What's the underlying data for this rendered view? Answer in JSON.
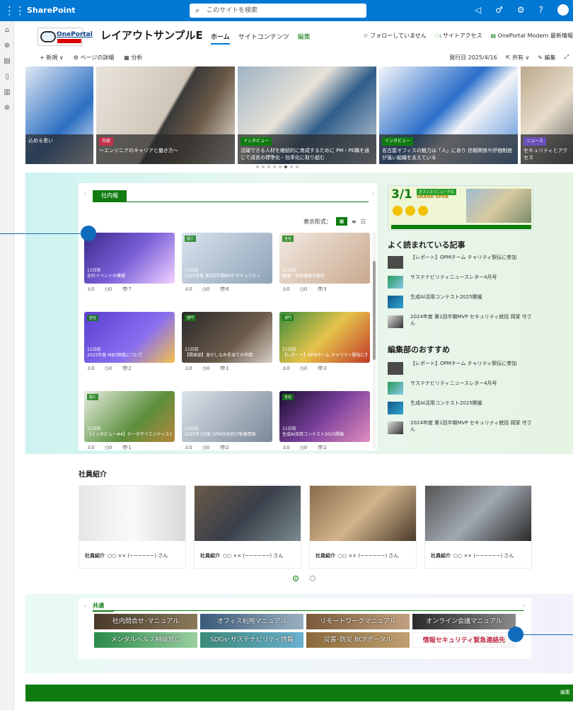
{
  "suitebar": {
    "app_name": "SharePoint",
    "search_placeholder": "このサイトを検索"
  },
  "header": {
    "logo_text": "OnePortal",
    "site_title": "レイアウトサンプルE",
    "nav": [
      "ホーム",
      "サイトコンテンツ",
      "編集"
    ],
    "follow": "☆ フォローしていません",
    "site_access": "サイトアクセス",
    "latest_info": "OnePortal Modern 最新情報"
  },
  "commandbar": {
    "new": "+ 新規 ∨",
    "page_details": "ページの詳細",
    "analytics": "分析",
    "published": "発行日 2025/4/16",
    "share": "共有 ∨",
    "edit": "編集"
  },
  "hero": [
    {
      "tag": "",
      "caption": "込める思い"
    },
    {
      "tag": "対談",
      "caption": "～エンジニアのキャリアと働き方～"
    },
    {
      "tag": "インタビュー",
      "caption": "活躍できる人材を継続的に育成するために PM・PE職を通じて成長の標準化・効率化に取り組む"
    },
    {
      "tag": "インタビュー",
      "caption": "名古屋オフィスの魅力は「人」にあり 信頼関係や評価制度が強い組織を支えている"
    },
    {
      "tag": "ニュース",
      "caption": "セキュリティとアクセス"
    }
  ],
  "news": {
    "tab": "社内報",
    "display_label": "表示形式：",
    "cards": [
      {
        "badge": "",
        "date": "11日前",
        "title": "全社イベントの模様",
        "likes": "0",
        "comments": "0",
        "views": "7"
      },
      {
        "badge": "個人",
        "date": "11日前",
        "title": "2025年度 第1回半期MVP セキュリティ",
        "likes": "0",
        "comments": "0",
        "views": "6"
      },
      {
        "badge": "全社",
        "date": "11日前",
        "title": "健康・身体健康の秘訣",
        "likes": "0",
        "comments": "0",
        "views": "3"
      },
      {
        "badge": "全社",
        "date": "11日前",
        "title": "2025年度 MBO制度について",
        "likes": "0",
        "comments": "0",
        "views": "2"
      },
      {
        "badge": "部門",
        "date": "11日前",
        "title": "【開発部】身だしなみ手当ての申請",
        "likes": "0",
        "comments": "0",
        "views": "1"
      },
      {
        "badge": "部門",
        "date": "11日前",
        "title": "【レポート】OPMチーム チャリティ駅伝に参加",
        "likes": "0",
        "comments": "0",
        "views": "3"
      },
      {
        "badge": "個人",
        "date": "11日前",
        "title": "【インタビュー#4】データサイエンティスト・岡部玲子さん",
        "likes": "0",
        "comments": "0",
        "views": "1"
      },
      {
        "badge": "",
        "date": "11日前",
        "title": "2025年3月度 OPM社内向け新着情報",
        "likes": "0",
        "comments": "0",
        "views": "2"
      },
      {
        "badge": "全社",
        "date": "11日前",
        "title": "生成AI活用コンテスト2025開催",
        "likes": "0",
        "comments": "0",
        "views": "2"
      }
    ]
  },
  "side": {
    "banner": {
      "date": "3/1",
      "tag": "オフィスリニューアル",
      "title": "GRAND OPEN"
    },
    "popular_title": "よく読まれている記事",
    "popular": [
      "【レポート】OPMチーム チャリティ駅伝に参加",
      "サステナビリティニュースレター4月号",
      "生成AI活用コンテスト2025開催",
      "2024年度 第1回半期MVP セキュリティ統括 岡家 守さん"
    ],
    "recommend_title": "編集部のおすすめ",
    "recommend": [
      "【レポート】OPMチーム チャリティ駅伝に参加",
      "サステナビリティニュースレター4月号",
      "生成AI活用コンテスト2025開催",
      "2024年度 第1回半期MVP セキュリティ統括 岡家 守さん"
    ]
  },
  "employees": {
    "title": "社員紹介",
    "cards": [
      {
        "label": "社員紹介",
        "name": "○○ ×× (~~~~~~) さん"
      },
      {
        "label": "社員紹介",
        "name": "○○ ×× (~~~~~~) さん"
      },
      {
        "label": "社員紹介",
        "name": "○○ ×× (~~~~~~) さん"
      },
      {
        "label": "社員紹介",
        "name": "○○ ×× (~~~~~~) さん"
      }
    ]
  },
  "common": {
    "tab": "共通",
    "links": [
      "社内問合せ･マニュアル",
      "オフィス利用マニュアル",
      "リモートワークマニュアル",
      "オンライン会議マニュアル",
      "メンタルヘルス相談窓口",
      "SDGs･サステナビリティ情報",
      "災害･防災 BCPポータル",
      "情報セキュリティ緊急連絡先"
    ]
  },
  "footer": {
    "text": "編集"
  }
}
